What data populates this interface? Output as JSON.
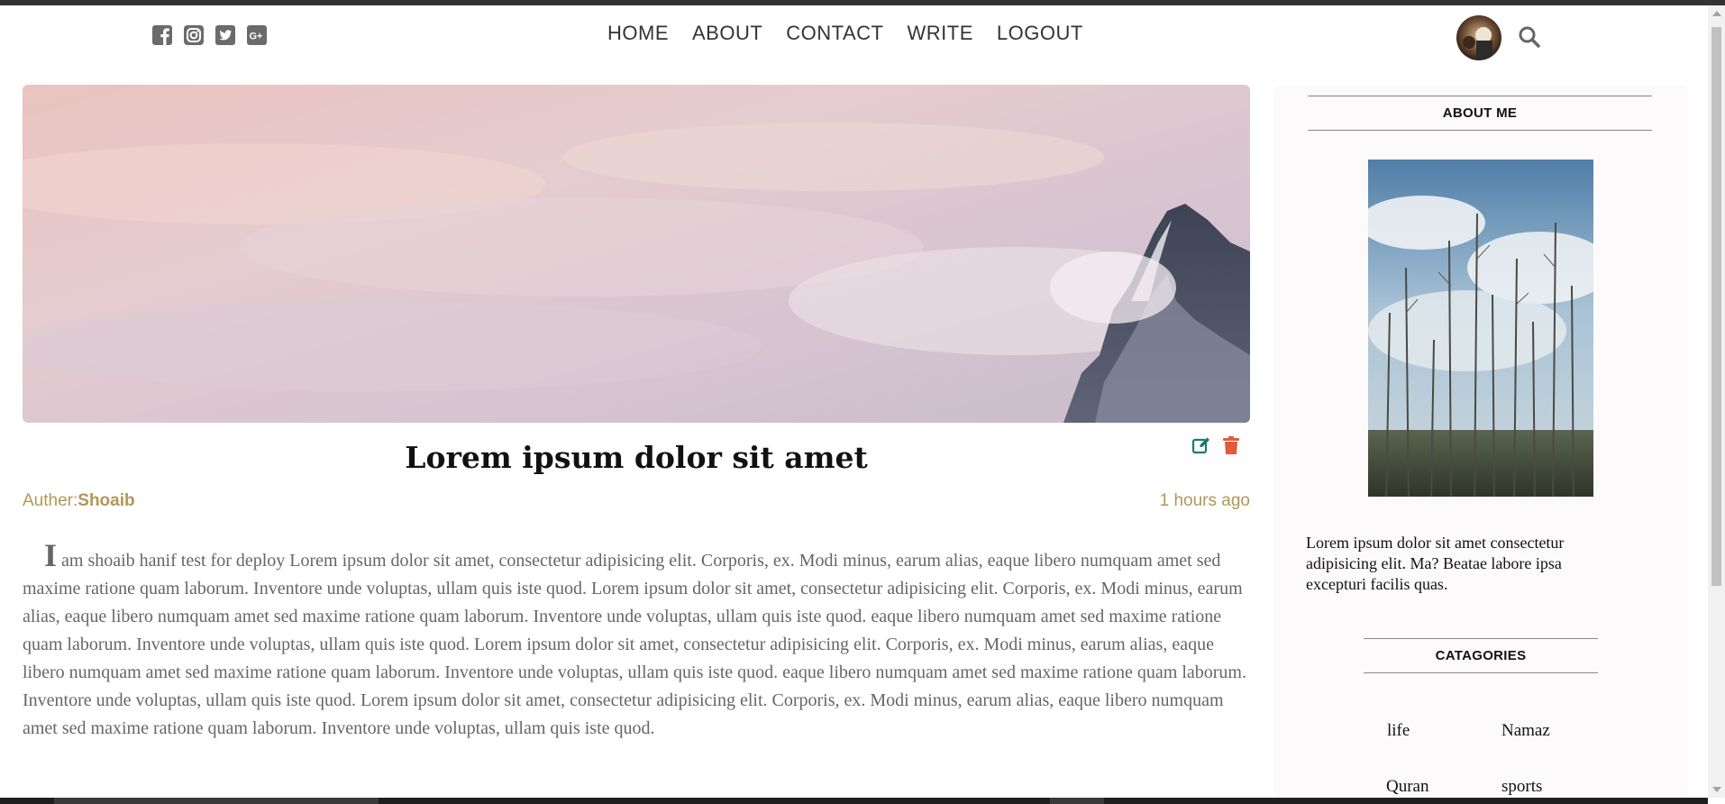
{
  "nav": {
    "social": [
      "facebook-icon",
      "instagram-icon",
      "twitter-icon",
      "google-plus-icon"
    ],
    "links": [
      "HOME",
      "ABOUT",
      "CONTACT",
      "WRITE",
      "LOGOUT"
    ]
  },
  "post": {
    "title": "Lorem ipsum dolor sit amet",
    "author_label": "Auther:",
    "author_name": "Shoaib",
    "time": "1 hours ago",
    "body_dropcap": "I",
    "body": "am shoaib hanif test for deploy Lorem ipsum dolor sit amet, consectetur adipisicing elit. Corporis, ex. Modi minus, earum alias, eaque libero numquam amet sed maxime ratione quam laborum. Inventore unde voluptas, ullam quis iste quod. Lorem ipsum dolor sit amet, consectetur adipisicing elit. Corporis, ex. Modi minus, earum alias, eaque libero numquam amet sed maxime ratione quam laborum. Inventore unde voluptas, ullam quis iste quod. eaque libero numquam amet sed maxime ratione quam laborum. Inventore unde voluptas, ullam quis iste quod. Lorem ipsum dolor sit amet, consectetur adipisicing elit. Corporis, ex. Modi minus, earum alias, eaque libero numquam amet sed maxime ratione quam laborum. Inventore unde voluptas, ullam quis iste quod. eaque libero numquam amet sed maxime ratione quam laborum. Inventore unde voluptas, ullam quis iste quod. Lorem ipsum dolor sit amet, consectetur adipisicing elit. Corporis, ex. Modi minus, earum alias, eaque libero numquam amet sed maxime ratione quam laborum. Inventore unde voluptas, ullam quis iste quod."
  },
  "sidebar": {
    "about_heading": "ABOUT ME",
    "about_text": "Lorem ipsum dolor sit amet consectetur adipisicing elit. Ma? Beatae labore ipsa excepturi facilis quas.",
    "categories_heading": "CATAGORIES",
    "categories": [
      "life",
      "Namaz",
      "Quran",
      "sports"
    ]
  },
  "colors": {
    "accent": "#b39656",
    "edit": "#1a7a72",
    "delete": "#e25a3a"
  }
}
